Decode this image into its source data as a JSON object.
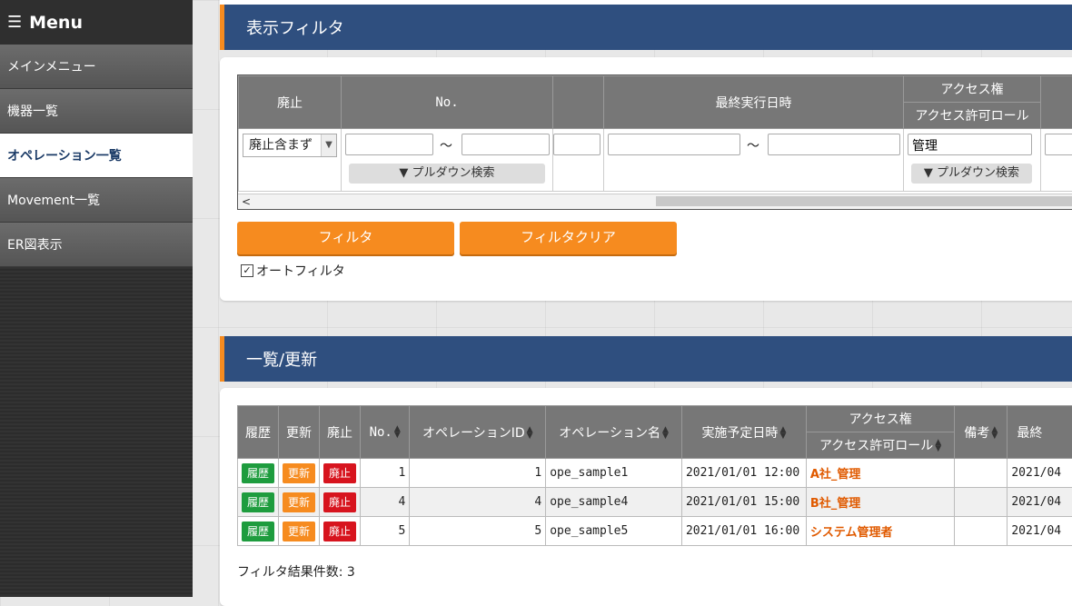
{
  "sidebar": {
    "title": "Menu",
    "items": [
      {
        "label": "メインメニュー",
        "active": false
      },
      {
        "label": "機器一覧",
        "active": false
      },
      {
        "label": "オペレーション一覧",
        "active": true
      },
      {
        "label": "Movement一覧",
        "active": false
      },
      {
        "label": "ER図表示",
        "active": false
      }
    ]
  },
  "filter_section": {
    "title": "表示フィルタ",
    "headers": {
      "discard": "廃止",
      "no": "No.",
      "last_run": "最終実行日時",
      "access": "アクセス権",
      "access_role": "アクセス許可ロール"
    },
    "discard_select_value": "廃止含まず",
    "tilde": "～",
    "access_role_value": "管理",
    "pulldown_label": "▼ プルダウン検索",
    "filter_button": "フィルタ",
    "clear_button": "フィルタクリア",
    "auto_filter_label": "オートフィルタ",
    "auto_filter_checked": true
  },
  "list_section": {
    "title": "一覧/更新",
    "headers": {
      "history": "履歴",
      "update": "更新",
      "discard": "廃止",
      "no": "No.",
      "operation_id": "オペレーションID",
      "operation_name": "オペレーション名",
      "scheduled": "実施予定日時",
      "access": "アクセス権",
      "access_role": "アクセス許可ロール",
      "note": "備考",
      "last": "最終"
    },
    "btn_history": "履歴",
    "btn_update": "更新",
    "btn_discard": "廃止",
    "rows": [
      {
        "no": "1",
        "id": "1",
        "name": "ope_sample1",
        "scheduled": "2021/01/01 12:00",
        "role": "A社_管理",
        "note": "",
        "last": "2021/04"
      },
      {
        "no": "4",
        "id": "4",
        "name": "ope_sample4",
        "scheduled": "2021/01/01 15:00",
        "role": "B社_管理",
        "note": "",
        "last": "2021/04"
      },
      {
        "no": "5",
        "id": "5",
        "name": "ope_sample5",
        "scheduled": "2021/01/01 16:00",
        "role": "システム管理者",
        "note": "",
        "last": "2021/04"
      }
    ],
    "result_count": "フィルタ結果件数: 3"
  },
  "colors": {
    "accent": "#f68b1f",
    "header": "#2f4f7f",
    "role_text": "#e05a00"
  }
}
